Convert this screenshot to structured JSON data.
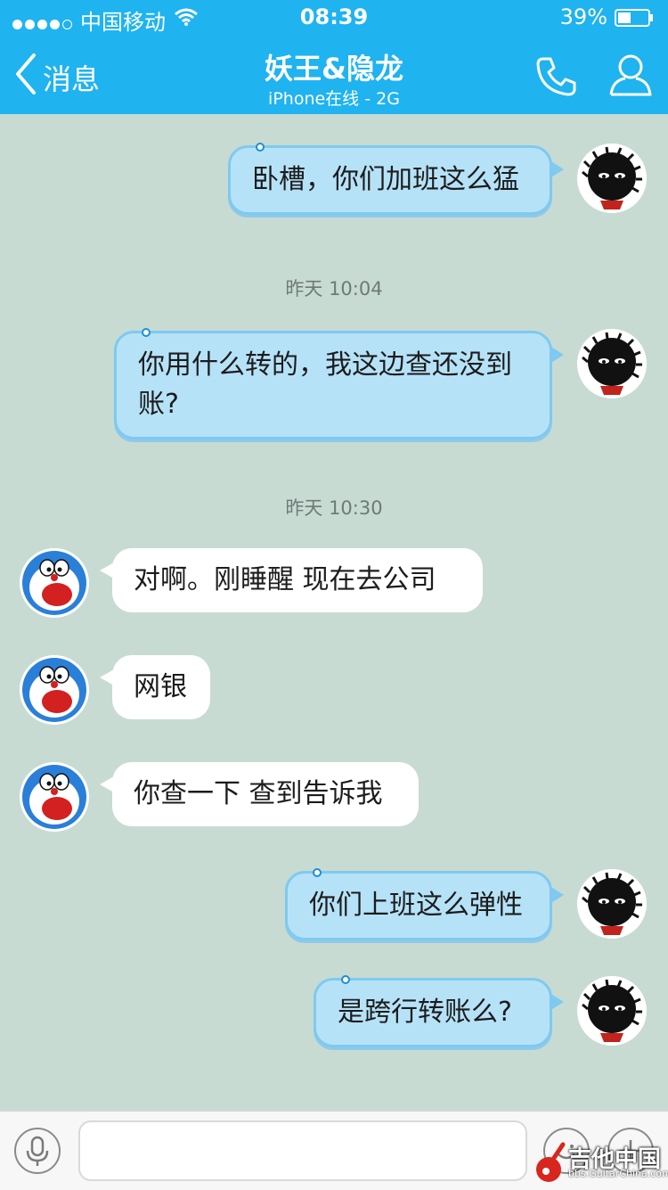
{
  "status_bar": {
    "carrier": "中国移动",
    "time": "08:39",
    "battery_percent": "39%",
    "signal_bars_filled": 4,
    "signal_bars_total": 5
  },
  "nav": {
    "back_label": "消息",
    "title": "妖王&隐龙",
    "subtitle": "iPhone在线 - 2G",
    "icons": [
      "chevron-left-icon",
      "phone-icon",
      "contact-icon"
    ]
  },
  "messages": [
    {
      "side": "right",
      "text": "卧槽，你们加班这么猛"
    },
    {
      "type": "timestamp",
      "text": "昨天 10:04"
    },
    {
      "side": "right",
      "line1": "你用什么转的，我这边查还没到",
      "line2": "账?"
    },
    {
      "type": "timestamp",
      "text": "昨天 10:30"
    },
    {
      "side": "left",
      "text": "对啊。刚睡醒 现在去公司"
    },
    {
      "side": "left",
      "text": "网银"
    },
    {
      "side": "left",
      "text": "你查一下 查到告诉我"
    },
    {
      "side": "right",
      "text": "你们上班这么弹性"
    },
    {
      "side": "right",
      "text": "是跨行转账么?"
    }
  ],
  "input_bar": {
    "placeholder": "",
    "icons": [
      "microphone-icon",
      "emoji-icon",
      "plus-icon"
    ]
  },
  "watermark": {
    "text": "吉他中国",
    "sub": "bbs.GuitarChina.com"
  },
  "colors": {
    "header": "#1fb3f0",
    "chat_background": "#c7dbd3",
    "my_bubble": "#b6e2f8",
    "friend_bubble": "#ffffff"
  }
}
